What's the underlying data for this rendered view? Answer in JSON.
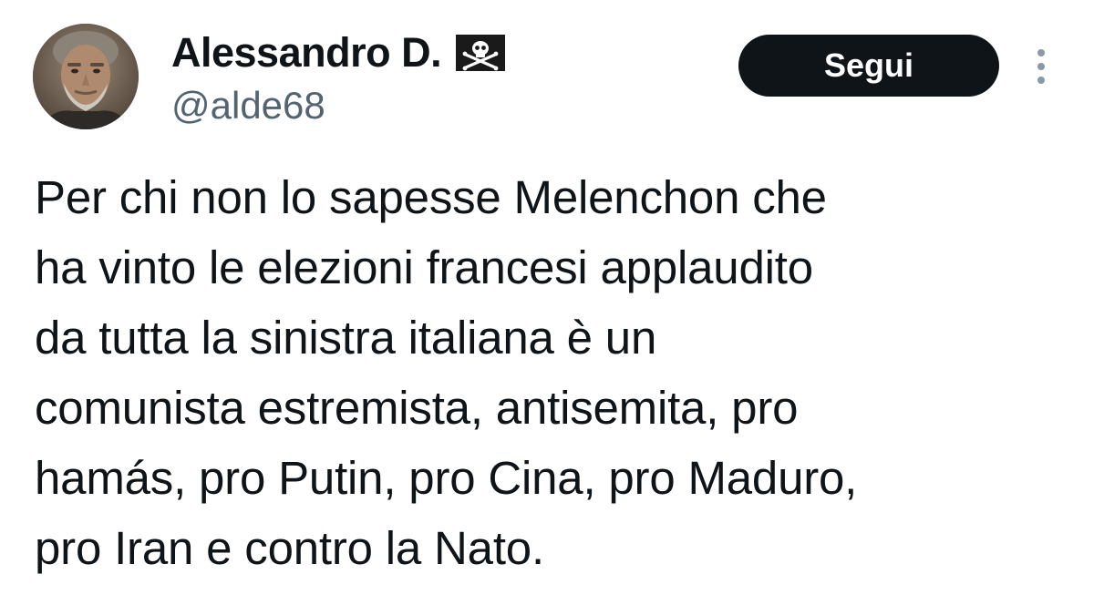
{
  "user": {
    "display_name": "Alessandro D.",
    "handle": "@alde68",
    "flag_emoji": "pirate-flag-icon",
    "avatar": "avatar-photo"
  },
  "actions": {
    "follow_label": "Segui",
    "more_icon": "more-vertical-icon"
  },
  "tweet": {
    "text_lines": [
      "Per chi non lo sapesse Melenchon che",
      "ha vinto le elezioni francesi applaudito",
      "da tutta la sinistra italiana è un",
      "comunista estremista, antisemita, pro",
      "hamás, pro Putin, pro Cina, pro Maduro,",
      "pro Iran e contro la Nato."
    ]
  },
  "colors": {
    "text_primary": "#0f1419",
    "text_secondary": "#536471",
    "button_bg": "#0f1419",
    "button_text": "#ffffff"
  }
}
